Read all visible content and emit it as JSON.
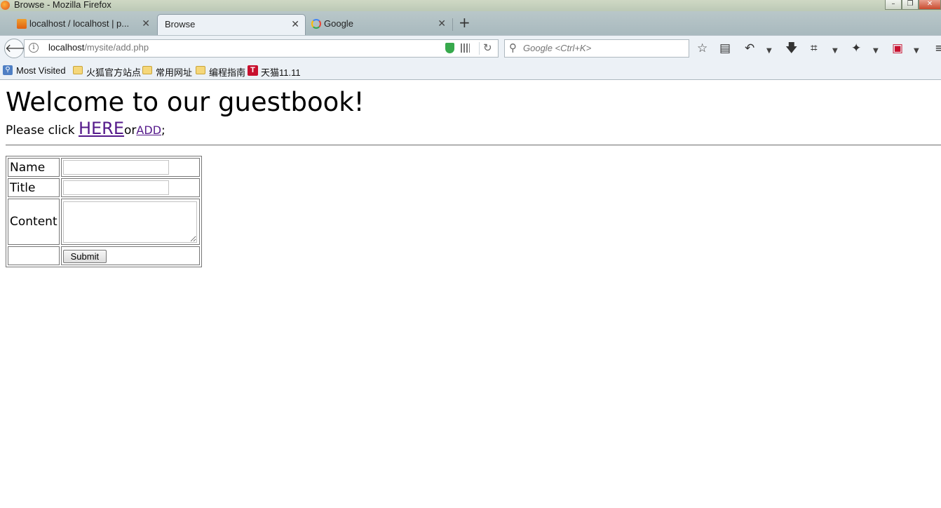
{
  "window": {
    "title": "Browse - Mozilla Firefox"
  },
  "tabs": [
    {
      "label": "localhost / localhost | p...",
      "icon": "phpmyadmin-icon",
      "active": false
    },
    {
      "label": "Browse",
      "icon": "",
      "active": true
    },
    {
      "label": "Google",
      "icon": "google-icon",
      "active": false
    }
  ],
  "navbar": {
    "url_host": "localhost",
    "url_path": "/mysite/add.php",
    "search_placeholder": "Google <Ctrl+K>"
  },
  "bookmarks": [
    {
      "label": "Most Visited",
      "icon": "most-visited-icon"
    },
    {
      "label": "火狐官方站点",
      "icon": "folder-icon"
    },
    {
      "label": "常用网址",
      "icon": "folder-icon"
    },
    {
      "label": "编程指南",
      "icon": "folder-icon"
    },
    {
      "label": "天猫11.11",
      "icon": "tmall-icon"
    }
  ],
  "page": {
    "heading": "Welcome to our guestbook!",
    "click_prefix": "Please click ",
    "here_link": "HERE",
    "or_text": "or",
    "add_link": "ADD",
    "suffix": ";",
    "form": {
      "name_label": "Name",
      "title_label": "Title",
      "content_label": "Content",
      "submit_label": "Submit"
    }
  }
}
